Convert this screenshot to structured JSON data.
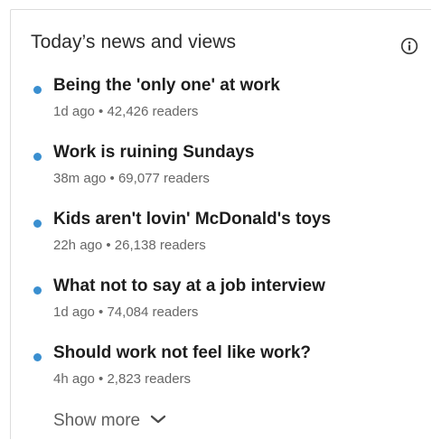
{
  "panel": {
    "title": "Today’s news and views",
    "info_icon": "info-circle-icon"
  },
  "colors": {
    "bullet": "#3a8fd0",
    "headline": "#1d1d1d",
    "meta": "#666666"
  },
  "news": [
    {
      "headline": "Being the 'only one' at work",
      "meta": "1d ago • 42,426 readers"
    },
    {
      "headline": "Work is ruining Sundays",
      "meta": "38m ago • 69,077 readers"
    },
    {
      "headline": "Kids aren't lovin' McDonald's toys",
      "meta": "22h ago • 26,138 readers"
    },
    {
      "headline": "What not to say at a job interview",
      "meta": "1d ago • 74,084 readers"
    },
    {
      "headline": "Should work not feel like work?",
      "meta": "4h ago • 2,823 readers"
    }
  ],
  "show_more": {
    "label": "Show more",
    "icon": "chevron-down-icon"
  }
}
